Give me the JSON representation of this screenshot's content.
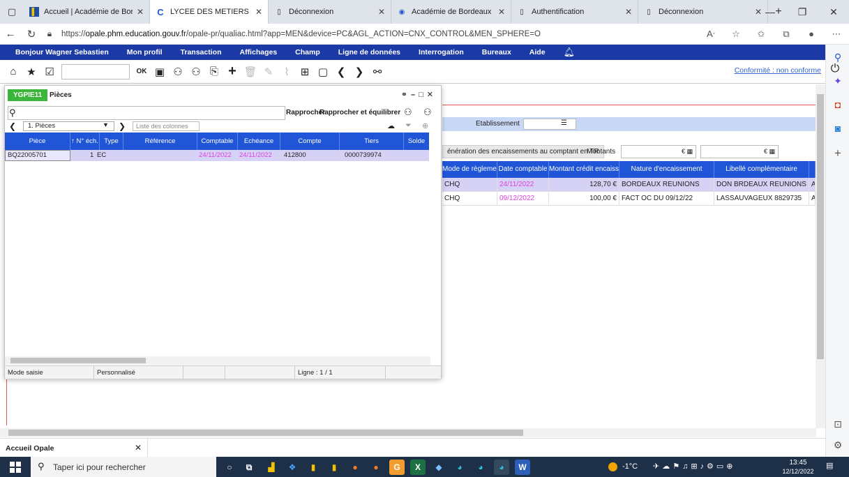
{
  "browser": {
    "tabs": [
      {
        "title": "Accueil | Académie de Bord",
        "favicon": "academie-logo",
        "active": false
      },
      {
        "title": "LYCEE DES METIERS BIARRIT",
        "favicon": "c-logo",
        "active": true
      },
      {
        "title": "Déconnexion",
        "favicon": "page-icon",
        "active": false
      },
      {
        "title": "Académie de Bordeaux : int",
        "favicon": "academie-round-icon",
        "active": false
      },
      {
        "title": "Authentification",
        "favicon": "page-icon",
        "active": false
      },
      {
        "title": "Déconnexion",
        "favicon": "page-icon",
        "active": false
      }
    ],
    "url_prefix": "https://",
    "url_host": "opale.phm.education.gouv.fr",
    "url_path": "/opale-pr/qualiac.html?app=MEN&device=PC&AGL_ACTION=CNX_CONTROL&MEN_SPHERE=O"
  },
  "menu": {
    "items": [
      "Bonjour Wagner Sebastien",
      "Mon profil",
      "Transaction",
      "Affichages",
      "Champ",
      "Ligne de données",
      "Interrogation",
      "Bureaux",
      "Aide"
    ]
  },
  "toolbar": {
    "ok_label": "OK",
    "conformite": "Conformité : non conforme"
  },
  "background": {
    "etablissement_label": "Etablissement",
    "generation_label": "énération des encaissements au comptant en TR",
    "montants_label": "Montants",
    "montant_field_1": "€",
    "montant_field_2": "€",
    "columns": [
      "Mode de règlement",
      "Date comptable",
      "Montant crédit encaissé",
      "Nature d'encaissement",
      "Libellé complémentaire"
    ],
    "rows": [
      {
        "mode": "CHQ",
        "date": "24/11/2022",
        "montant": "128,70 €",
        "nature": "BORDEAUX REUNIONS",
        "libelle": "DON BRDEAUX REUNIONS CHQ ...",
        "extra": "A"
      },
      {
        "mode": "CHQ",
        "date": "09/12/2022",
        "montant": "100,00 €",
        "nature": "FACT OC DU 09/12/22",
        "libelle": "LASSAUVAGEUX 8829735",
        "extra": "A"
      }
    ]
  },
  "panel": {
    "code": "YGPIE11",
    "title": "Pièces",
    "rapprocher_label": "Rapprocher",
    "rapprocher_eq_label": "Rapprocher et équilibrer",
    "selection": "1. Pièces",
    "columns_placeholder": "Liste des colonnes",
    "columns": [
      "Pièce",
      "↑ N° éch.",
      "Type",
      "Référence",
      "Comptable",
      "Echéance",
      "Compte",
      "Tiers",
      "Solde"
    ],
    "row": {
      "piece": "BQ22005701",
      "num": "1",
      "type": "EC",
      "reference": "",
      "comptable": "24/11/2022",
      "echeance": "24/11/2022",
      "compte": "412800",
      "tiers": "0000739974"
    },
    "status": {
      "mode": "Mode saisie",
      "perso": "Personnalisé",
      "ligne": "Ligne : 1 / 1"
    }
  },
  "apptab": {
    "label": "Accueil Opale"
  },
  "taskbar": {
    "search_placeholder": "Taper ici pour rechercher",
    "temperature": "-1°C",
    "time": "13:45",
    "date": "12/12/2022"
  },
  "colors": {
    "menu_bar": "#1c3aa6",
    "grid_header": "#1f55d6",
    "selected_row": "#d5d2f5",
    "date_pink": "#e040e0",
    "panel_code": "#3bb63b"
  }
}
